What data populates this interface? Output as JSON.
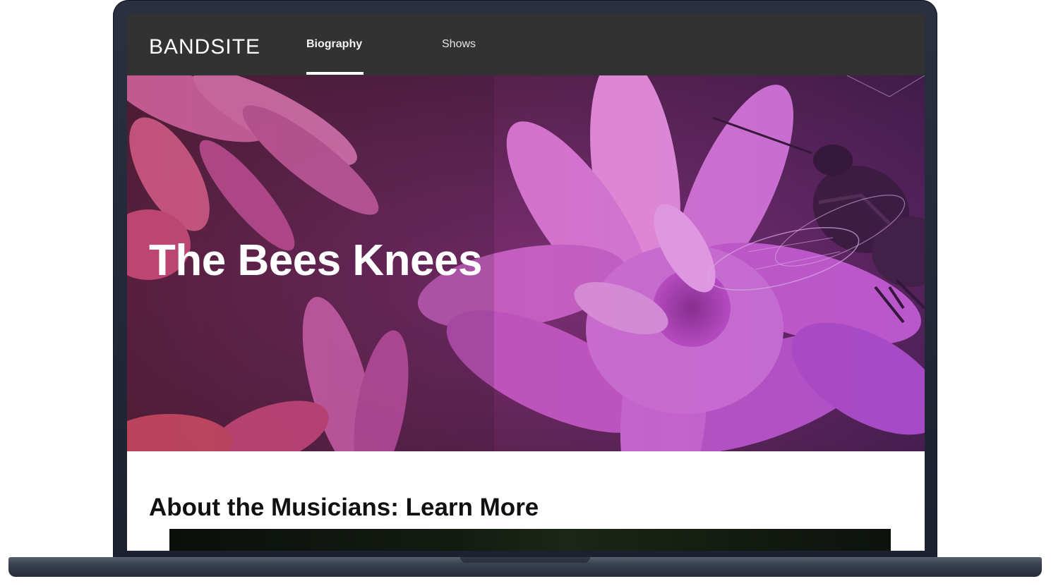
{
  "nav": {
    "logo": "BANDSITE",
    "links": [
      {
        "label": "Biography",
        "active": true
      },
      {
        "label": "Shows",
        "active": false
      }
    ]
  },
  "hero": {
    "title": "The Bees Knees",
    "image": "pink flowers with a bee"
  },
  "section": {
    "title": "About the Musicians: Learn More"
  },
  "colors": {
    "nav_bg": "#323232",
    "hero_tint": "#b03cc8",
    "text_dark": "#111111"
  }
}
